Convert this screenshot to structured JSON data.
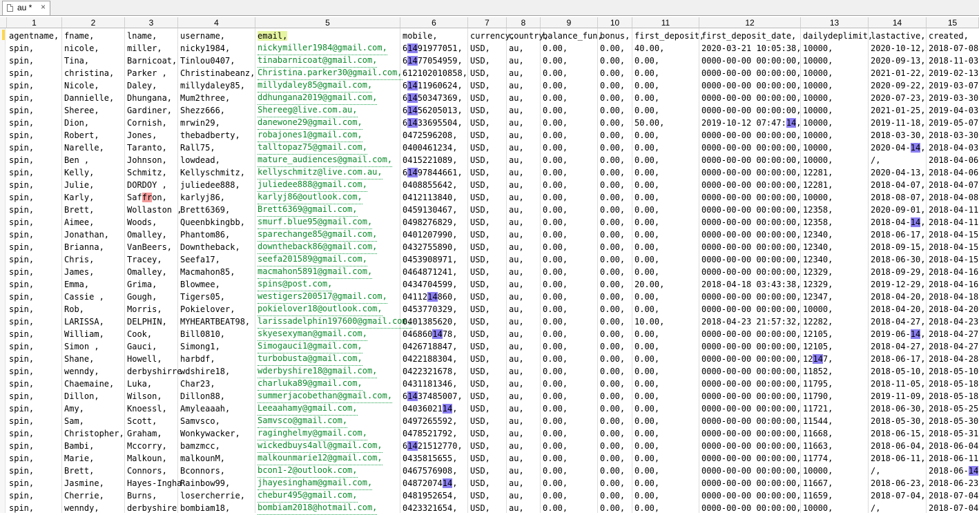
{
  "tab": {
    "title": "au *",
    "close_glyph": "×",
    "icon": "file-icon"
  },
  "column_numbers": [
    "1",
    "2",
    "3",
    "4",
    "5",
    "6",
    "7",
    "8",
    "9",
    "10",
    "11",
    "12",
    "13",
    "14",
    "15"
  ],
  "header_row": [
    "agentname,",
    "fname,",
    "lname,",
    "username,",
    "email,",
    "mobile,",
    "currency,",
    "country,",
    "balance_fun,",
    "bonus,",
    "first_deposit,",
    "first_deposit_date,",
    "dailydeplimit,",
    "lastactive,",
    "created,"
  ],
  "rows": [
    [
      "spin,",
      "nicole,",
      "miller,",
      "nicky1984,",
      "nickymiller1984@gmail.com,",
      "61491977051,",
      "USD,",
      "au,",
      "0.00,",
      "0.00,",
      "40.00,",
      "2020-03-21 10:05:38,",
      "10000,",
      "2020-10-12,",
      "2018-07-08"
    ],
    [
      "spin,",
      "Tina,",
      "Barnicoat,",
      "Tinlou0407,",
      "tinabarnicoat@gmail.com,",
      "61477054959,",
      "USD,",
      "au,",
      "0.00,",
      "0.00,",
      "0.00,",
      "0000-00-00 00:00:00,",
      "10000,",
      "2020-09-13,",
      "2018-11-03"
    ],
    [
      "spin,",
      "christina,",
      "Parker ,",
      "Christinabeanz,",
      "Christina.parker30@gmail.com,",
      "612102010858,",
      "USD,",
      "au,",
      "0.00,",
      "0.00,",
      "0.00,",
      "0000-00-00 00:00:00,",
      "10000,",
      "2021-01-22,",
      "2019-02-13"
    ],
    [
      "spin,",
      "Nicole,",
      "Daley,",
      "millydaley85,",
      "millydaley85@gmail.com,",
      "61411960624,",
      "USD,",
      "au,",
      "0.00,",
      "0.00,",
      "0.00,",
      "0000-00-00 00:00:00,",
      "10000,",
      "2020-09-22,",
      "2019-03-07"
    ],
    [
      "spin,",
      "Dannielle,",
      "Dhungana,",
      "Mum2three,",
      "ddhungana2019@gmail.com,",
      "61450347369,",
      "USD,",
      "au,",
      "0.00,",
      "0.00,",
      "0.00,",
      "0000-00-00 00:00:00,",
      "10000,",
      "2020-07-23,",
      "2019-03-30"
    ],
    [
      "spin,",
      "Sheree,",
      "Gardiner,",
      "Shezz666,",
      "Shereeg@live.com.au,",
      "61456205013,",
      "USD,",
      "au,",
      "0.00,",
      "0.00,",
      "0.00,",
      "0000-00-00 00:00:00,",
      "10000,",
      "2021-01-25,",
      "2019-04-03"
    ],
    [
      "spin,",
      "Dion,",
      "Cornish,",
      "mrwin29,",
      "danewone29@gmail.com,",
      "61433695504,",
      "USD,",
      "au,",
      "0.00,",
      "0.00,",
      "50.00,",
      "2019-10-12 07:47:14,",
      "10000,",
      "2019-11-18,",
      "2019-05-07"
    ],
    [
      "spin,",
      "Robert,",
      "Jones,",
      "thebadberty,",
      "robajones1@gmail.com,",
      "0472596208,",
      "USD,",
      "au,",
      "0.00,",
      "0.00,",
      "0.00,",
      "0000-00-00 00:00:00,",
      "10000,",
      "2018-03-30,",
      "2018-03-30"
    ],
    [
      "spin,",
      "Narelle,",
      "Taranto,",
      "Rall75,",
      "talltopaz75@gmail.com,",
      "0400461234,",
      "USD,",
      "au,",
      "0.00,",
      "0.00,",
      "0.00,",
      "0000-00-00 00:00:00,",
      "10000,",
      "2020-04-14,",
      "2018-04-03"
    ],
    [
      "spin,",
      "Ben ,",
      "Johnson,",
      "lowdead,",
      "mature_audiences@gmail.com,",
      "0415221089,",
      "USD,",
      "au,",
      "0.00,",
      "0.00,",
      "0.00,",
      "0000-00-00 00:00:00,",
      "10000,",
      "/,",
      "2018-04-06"
    ],
    [
      "spin,",
      "Kelly,",
      "Schmitz,",
      "Kellyschmitz,",
      "kellyschmitz@live.com.au,",
      "61497844661,",
      "USD,",
      "au,",
      "0.00,",
      "0.00,",
      "0.00,",
      "0000-00-00 00:00:00,",
      "12281,",
      "2020-04-13,",
      "2018-04-06"
    ],
    [
      "spin,",
      "Julie,",
      "DORDOY ,",
      "juliedee888,",
      "juliedee888@gmail.com,",
      "0408855642,",
      "USD,",
      "au,",
      "0.00,",
      "0.00,",
      "0.00,",
      "0000-00-00 00:00:00,",
      "12281,",
      "2018-04-07,",
      "2018-04-07"
    ],
    [
      "spin,",
      "Karly,",
      "Saffron,",
      "karlyj86,",
      "karlyj86@outlook.com,",
      "0412113840,",
      "USD,",
      "au,",
      "0.00,",
      "0.00,",
      "0.00,",
      "0000-00-00 00:00:00,",
      "10000,",
      "2018-08-07,",
      "2018-04-08"
    ],
    [
      "spin,",
      "Brett,",
      "Wollaston ,",
      "Brett6369,",
      "Brett6369@gmail.com,",
      "0459130467,",
      "USD,",
      "au,",
      "0.00,",
      "0.00,",
      "0.00,",
      "0000-00-00 00:00:00,",
      "12358,",
      "2020-09-01,",
      "2018-04-11"
    ],
    [
      "spin,",
      "Aimee,",
      "Woods,",
      "Queenbkingbb,",
      "smurf.blue95@gmail.com,",
      "0498276829,",
      "USD,",
      "au,",
      "0.00,",
      "0.00,",
      "0.00,",
      "0000-00-00 00:00:00,",
      "12358,",
      "2018-04-14,",
      "2018-04-11"
    ],
    [
      "spin,",
      "Jonathan,",
      "Omalley,",
      "Phantom86,",
      "sparechange85@gmail.com,",
      "0401207990,",
      "USD,",
      "au,",
      "0.00,",
      "0.00,",
      "0.00,",
      "0000-00-00 00:00:00,",
      "12340,",
      "2018-06-17,",
      "2018-04-15"
    ],
    [
      "spin,",
      "Brianna,",
      "VanBeers,",
      "Downtheback,",
      "downtheback86@gmail.com,",
      "0432755890,",
      "USD,",
      "au,",
      "0.00,",
      "0.00,",
      "0.00,",
      "0000-00-00 00:00:00,",
      "12340,",
      "2018-09-15,",
      "2018-04-15"
    ],
    [
      "spin,",
      "Chris,",
      "Tracey,",
      "Seefa17,",
      "seefa201589@gmail.com,",
      "0453908971,",
      "USD,",
      "au,",
      "0.00,",
      "0.00,",
      "0.00,",
      "0000-00-00 00:00:00,",
      "12340,",
      "2018-06-30,",
      "2018-04-15"
    ],
    [
      "spin,",
      "James,",
      "Omalley,",
      "Macmahon85,",
      "macmahon5891@gmail.com,",
      "0464871241,",
      "USD,",
      "au,",
      "0.00,",
      "0.00,",
      "0.00,",
      "0000-00-00 00:00:00,",
      "12329,",
      "2018-09-29,",
      "2018-04-16"
    ],
    [
      "spin,",
      "Emma,",
      "Grima,",
      "Blowmee,",
      "spins@post.com,",
      "0434704599,",
      "USD,",
      "au,",
      "0.00,",
      "0.00,",
      "20.00,",
      "2018-04-18 03:43:38,",
      "12329,",
      "2019-12-29,",
      "2018-04-16"
    ],
    [
      "spin,",
      "Cassie ,",
      "Gough,",
      "Tigers05,",
      "westigers200517@gmail.com,",
      "0411214860,",
      "USD,",
      "au,",
      "0.00,",
      "0.00,",
      "0.00,",
      "0000-00-00 00:00:00,",
      "12347,",
      "2018-04-20,",
      "2018-04-18"
    ],
    [
      "spin,",
      "Rob,",
      "Morris,",
      "Pokielover,",
      "pokielover18@outlook.com,",
      "0453770329,",
      "USD,",
      "au,",
      "0.00,",
      "0.00,",
      "0.00,",
      "0000-00-00 00:00:00,",
      "10000,",
      "2018-04-20,",
      "2018-04-20"
    ],
    [
      "spin,",
      "LARISSA,",
      "DELPHIN,",
      "MYHEARTBEAT98,",
      "larissadelphin197600@gmail.com,",
      "0401385620,",
      "USD,",
      "au,",
      "0.00,",
      "0.00,",
      "10.00,",
      "2018-04-23 21:57:32,",
      "12282,",
      "2018-04-27,",
      "2018-04-23"
    ],
    [
      "spin,",
      "William,",
      "Cook,",
      "Bill0810,",
      "skyesexyman@gmail.com,",
      "0468601478,",
      "USD,",
      "au,",
      "0.00,",
      "0.00,",
      "0.00,",
      "0000-00-00 00:00:00,",
      "12105,",
      "2019-06-14,",
      "2018-04-27"
    ],
    [
      "spin,",
      "Simon ,",
      "Gauci,",
      "Simong1,",
      "Simogauci1@gmail.com,",
      "0426718847,",
      "USD,",
      "au,",
      "0.00,",
      "0.00,",
      "0.00,",
      "0000-00-00 00:00:00,",
      "12105,",
      "2018-04-27,",
      "2018-04-27"
    ],
    [
      "spin,",
      "Shane,",
      "Howell,",
      "harbdf,",
      "turbobusta@gmail.com,",
      "0422188304,",
      "USD,",
      "au,",
      "0.00,",
      "0.00,",
      "0.00,",
      "0000-00-00 00:00:00,",
      "12147,",
      "2018-06-17,",
      "2018-04-28"
    ],
    [
      "spin,",
      "wenndy,",
      "derbyshirre",
      "wdshire18,",
      "wderbyshire18@gmail.com,",
      "0422321678,",
      "USD,",
      "au,",
      "0.00,",
      "0.00,",
      "0.00,",
      "0000-00-00 00:00:00,",
      "11852,",
      "2018-05-10,",
      "2018-05-10"
    ],
    [
      "spin,",
      "Chaemaine,",
      "Luka,",
      "Char23,",
      "charluka89@gmail.com,",
      "0431181346,",
      "USD,",
      "au,",
      "0.00,",
      "0.00,",
      "0.00,",
      "0000-00-00 00:00:00,",
      "11795,",
      "2018-11-05,",
      "2018-05-18"
    ],
    [
      "spin,",
      "Dillon,",
      "Wilson,",
      "Dillon88,",
      "summerjacobethan@gmail.com,",
      "61437485007,",
      "USD,",
      "au,",
      "0.00,",
      "0.00,",
      "0.00,",
      "0000-00-00 00:00:00,",
      "11790,",
      "2019-11-09,",
      "2018-05-18"
    ],
    [
      "spin,",
      "Amy,",
      "Knoessl,",
      "Amyleaaah,",
      "Leeaahamy@gmail.com,",
      "0403602114,",
      "USD,",
      "au,",
      "0.00,",
      "0.00,",
      "0.00,",
      "0000-00-00 00:00:00,",
      "11721,",
      "2018-06-30,",
      "2018-05-25"
    ],
    [
      "spin,",
      "Sam,",
      "Scott,",
      "Samvsco,",
      "Samvsco@gmail.com,",
      "0497265592,",
      "USD,",
      "au,",
      "0.00,",
      "0.00,",
      "0.00,",
      "0000-00-00 00:00:00,",
      "11544,",
      "2018-05-30,",
      "2018-05-30"
    ],
    [
      "spin,",
      "Christopher,",
      "Graham,",
      "Wonkywacker,",
      "raginghelmy@gmail.com,",
      "0478521792,",
      "USD,",
      "au,",
      "0.00,",
      "0.00,",
      "0.00,",
      "0000-00-00 00:00:00,",
      "11668,",
      "2018-06-15,",
      "2018-05-31"
    ],
    [
      "spin,",
      "Bambi,",
      "Mccorry,",
      "bamzmcc,",
      "wickedbuys4all@gmail.com,",
      "61421512770,",
      "USD,",
      "au,",
      "0.00,",
      "0.00,",
      "0.00,",
      "0000-00-00 00:00:00,",
      "11663,",
      "2018-06-04,",
      "2018-06-04"
    ],
    [
      "spin,",
      "Marie,",
      "Malkoun,",
      "malkounM,",
      "malkounmarie12@gmail.com,",
      "0435815655,",
      "USD,",
      "au,",
      "0.00,",
      "0.00,",
      "0.00,",
      "0000-00-00 00:00:00,",
      "11774,",
      "2018-06-11,",
      "2018-06-11"
    ],
    [
      "spin,",
      "Brett,",
      "Connors,",
      "Bconnors,",
      "bcon1-2@outlook.com,",
      "0467576908,",
      "USD,",
      "au,",
      "0.00,",
      "0.00,",
      "0.00,",
      "0000-00-00 00:00:00,",
      "10000,",
      "/,",
      "2018-06-14"
    ],
    [
      "spin,",
      "Jasmine,",
      "Hayes-Ingha",
      "Rainbow99,",
      "jhayesingham@gmail.com,",
      "0487207414,",
      "USD,",
      "au,",
      "0.00,",
      "0.00,",
      "0.00,",
      "0000-00-00 00:00:00,",
      "11667,",
      "2018-06-23,",
      "2018-06-23"
    ],
    [
      "spin,",
      "Cherrie,",
      "Burns,",
      "losercherrie,",
      "chebur495@gmail.com,",
      "0481952654,",
      "USD,",
      "au,",
      "0.00,",
      "0.00,",
      "0.00,",
      "0000-00-00 00:00:00,",
      "11659,",
      "2018-07-04,",
      "2018-07-04"
    ],
    [
      "spin,",
      "wenndy,",
      "derbyshire",
      "bombiam18,",
      "bombiam2018@hotmail.com,",
      "0423321654,",
      "USD,",
      "au,",
      "0.00,",
      "0.00,",
      "0.00,",
      "0000-00-00 00:00:00,",
      "10000,",
      "/,",
      "2018-07-04"
    ]
  ],
  "colors": {
    "email_text": "#0b8a2a",
    "search_highlight": "#8b7ff0",
    "selection_highlight": "#f29a9a",
    "header_email_bg": "#e5f5a0",
    "current_line_marker": "#ffd74a"
  }
}
